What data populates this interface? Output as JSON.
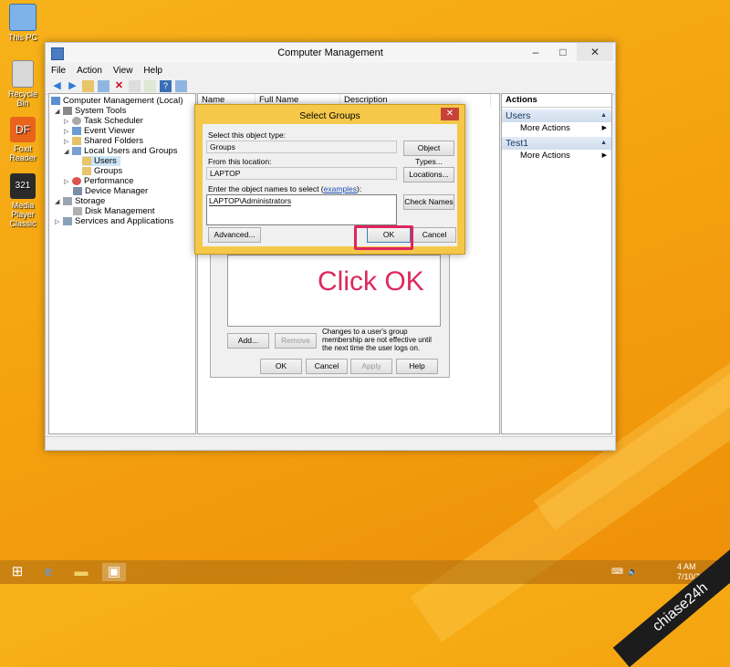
{
  "desktop": {
    "icons": [
      {
        "label": "This PC"
      },
      {
        "label": "Recycle Bin"
      },
      {
        "label": "Foxit Reader"
      },
      {
        "label": "Media Player Classic"
      }
    ]
  },
  "window": {
    "title": "Computer Management",
    "menu": [
      "File",
      "Action",
      "View",
      "Help"
    ]
  },
  "tree": {
    "root": "Computer Management (Local)",
    "items": [
      {
        "label": "System Tools"
      },
      {
        "label": "Task Scheduler"
      },
      {
        "label": "Event Viewer"
      },
      {
        "label": "Shared Folders"
      },
      {
        "label": "Local Users and Groups"
      },
      {
        "label": "Users"
      },
      {
        "label": "Groups"
      },
      {
        "label": "Performance"
      },
      {
        "label": "Device Manager"
      },
      {
        "label": "Storage"
      },
      {
        "label": "Disk Management"
      },
      {
        "label": "Services and Applications"
      }
    ]
  },
  "list": {
    "columns": [
      "Name",
      "Full Name",
      "Description"
    ]
  },
  "actions": {
    "header": "Actions",
    "sections": [
      {
        "title": "Users",
        "item": "More Actions"
      },
      {
        "title": "Test1",
        "item": "More Actions"
      }
    ]
  },
  "properties": {
    "add": "Add...",
    "remove": "Remove",
    "note": "Changes to a user's group membership are not effective until the next time the user logs on.",
    "ok": "OK",
    "cancel": "Cancel",
    "apply": "Apply",
    "help": "Help"
  },
  "dialog": {
    "title": "Select Groups",
    "object_type_label": "Select this object type:",
    "object_type_value": "Groups",
    "object_types_button": "Object Types...",
    "location_label": "From this location:",
    "location_value": "LAPTOP",
    "locations_button": "Locations...",
    "names_label_prefix": "Enter the object names to select (",
    "names_label_link": "examples",
    "names_label_suffix": "):",
    "names_value": "LAPTOP\\Administrators",
    "check_names_button": "Check Names",
    "advanced_button": "Advanced...",
    "ok_button": "OK",
    "cancel_button": "Cancel"
  },
  "annotation": "Click OK",
  "taskbar": {
    "clock": "4 AM",
    "date": "7/10/2015"
  },
  "watermark": "chiase24h"
}
